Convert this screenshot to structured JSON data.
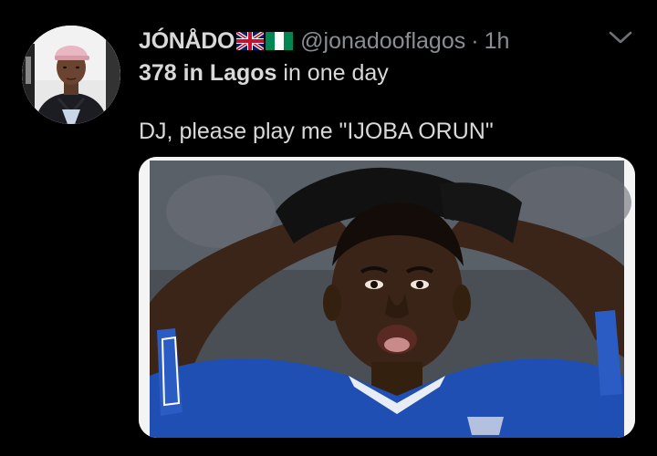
{
  "tweet": {
    "author": {
      "display_name": "JÓNÅDO",
      "flags": [
        "uk-flag-icon",
        "nigeria-flag-icon"
      ],
      "handle": "@jonadooflagos",
      "separator": "·",
      "timestamp": "1h"
    },
    "bio_line": {
      "bold": "378 in Lagos",
      "rest": " in one day"
    },
    "text": "DJ, please play me \"IJOBA ORUN\"",
    "menu_icon": "chevron-down-icon",
    "media": {
      "description_icon": "photo",
      "colors": {
        "jersey": "#1f4fb3",
        "skin": "#3a2418",
        "gloves": "#111111",
        "background": "#4a4f55"
      }
    }
  },
  "colors": {
    "background": "#000000",
    "primary_text": "#d9d9d9",
    "secondary_text": "#8a8d91"
  }
}
